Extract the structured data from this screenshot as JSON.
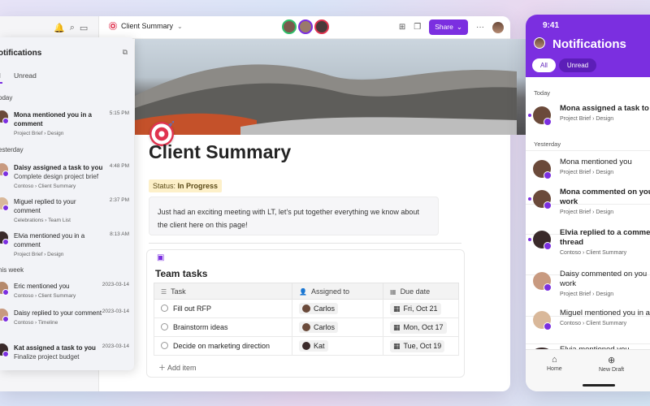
{
  "toolbar": {
    "doc_title": "Client Summary",
    "share_label": "Share"
  },
  "page": {
    "title": "Client Summary",
    "status_prefix": "Status:",
    "status_value": "In Progress",
    "callout_text": "Just had an exciting meeting with LT, let’s put together everything we know about the client here on this page!"
  },
  "tasks": {
    "title": "Team tasks",
    "headers": [
      "Task",
      "Assigned to",
      "Due date"
    ],
    "rows": [
      {
        "task": "Fill out RFP",
        "assignee": "Carlos",
        "due": "Fri, Oct 21"
      },
      {
        "task": "Brainstorm ideas",
        "assignee": "Carlos",
        "due": "Mon, Oct 17"
      },
      {
        "task": "Decide on marketing direction",
        "assignee": "Kat",
        "due": "Tue, Oct 19"
      }
    ],
    "add_label": "Add item"
  },
  "notifications": {
    "title": "otifications",
    "tabs": [
      "ll",
      "Unread"
    ],
    "sections": {
      "today": "oday",
      "yesterday": "esterday",
      "this_week": "his week"
    },
    "items": [
      {
        "text": "Mona mentioned you in a comment",
        "sub": "",
        "crumb": "Project Brief › Design",
        "time": "5:15 PM"
      },
      {
        "text": "Daisy assigned a task to you",
        "sub": "Complete design project brief",
        "crumb": "Contoso › Client Summary",
        "time": "4:48 PM"
      },
      {
        "text": "Miguel replied to your comment",
        "sub": "",
        "crumb": "Celebrations › Team List",
        "time": "2:37 PM"
      },
      {
        "text": "Elvia mentioned you in a comment",
        "sub": "",
        "crumb": "Project Brief › Design",
        "time": "8:13 AM"
      },
      {
        "text": "Eric mentioned you",
        "sub": "",
        "crumb": "Contoso › Client Summary",
        "time": "2023-03-14"
      },
      {
        "text": "Daisy replied to your comment",
        "sub": "",
        "crumb": "Contoso › Timeline",
        "time": "2023-03-14"
      },
      {
        "text": "Kat assigned a task to you",
        "sub": "Finalize project budget",
        "crumb": "",
        "time": "2023-03-14"
      }
    ]
  },
  "phone": {
    "time": "9:41",
    "title": "Notifications",
    "tabs": [
      "All",
      "Unread"
    ],
    "sections": {
      "today": "Today",
      "yesterday": "Yesterday"
    },
    "items": [
      {
        "text": "Mona assigned a task to",
        "crumb": "Project Brief › Design",
        "bold": true
      },
      {
        "text": "Mona mentioned you",
        "crumb": "Project Brief › Design",
        "bold": false
      },
      {
        "text": "Mona commented on you work",
        "crumb": "Project Brief › Design",
        "bold": true
      },
      {
        "text": "Elvia replied to a comme thread",
        "crumb": "Contoso › Client Summary",
        "bold": true
      },
      {
        "text": "Daisy commented on you work",
        "crumb": "Project Brief › Design",
        "bold": false
      },
      {
        "text": "Miguel mentioned you in a",
        "crumb": "Contoso › Client Summary",
        "bold": false
      },
      {
        "text": "Elvia mentioned you",
        "crumb": "",
        "bold": false
      }
    ],
    "nav": [
      "Home",
      "New Draft"
    ]
  },
  "colors": {
    "accent": "#7b2fe0",
    "status_bg": "#fdf0c9"
  }
}
